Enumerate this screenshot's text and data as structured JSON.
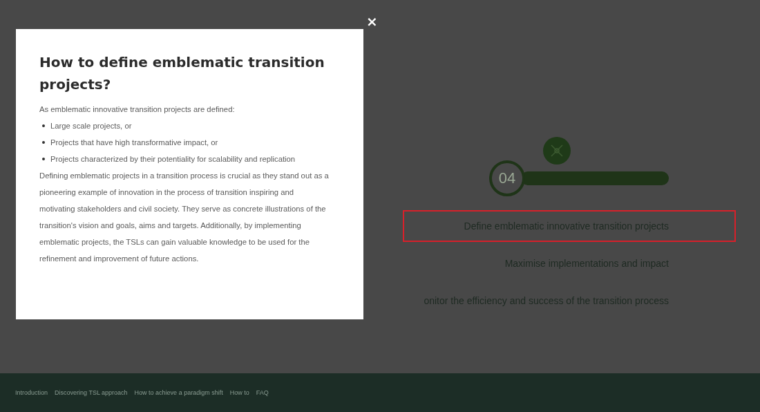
{
  "step": {
    "number": "04"
  },
  "steps": [
    {
      "label": "Define emblematic innovative transition projects",
      "selected": true
    },
    {
      "label": "Maximise implementations and impact",
      "selected": false
    },
    {
      "label": "onitor the efficiency and success of the transition process",
      "selected": false
    }
  ],
  "footer": {
    "links": [
      "Introduction",
      "Discovering TSL approach",
      "How to achieve a paradigm shift",
      "How to",
      "FAQ"
    ]
  },
  "modal": {
    "close": "×",
    "title": "How to define emblematic transition projects?",
    "intro": "As emblematic innovative transition projects are defined:",
    "bullets": [
      "Large scale projects, or",
      "Projects that have high transformative impact, or",
      "Projects characterized by their potentiality for scalability and replication"
    ],
    "paragraph": "Defining emblematic projects in a transition process is crucial as they stand out as a pioneering example of innovation in the process of transition inspiring and motivating stakeholders and civil society. They serve as concrete illustrations of the transition's vision and goals, aims and targets. Additionally, by implementing emblematic projects, the TSLs can gain valuable knowledge to be used for the refinement and improvement of future actions."
  }
}
